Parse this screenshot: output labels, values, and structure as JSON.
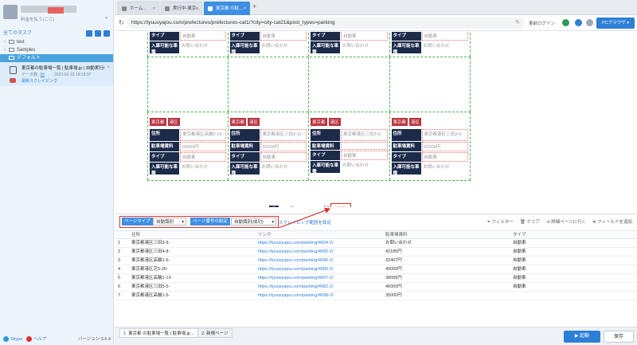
{
  "sidebar": {
    "account_sub": "料金を払う(ここ)",
    "all_tasks": "全てのタスク",
    "tree": [
      {
        "label": "test"
      },
      {
        "label": "Samples"
      },
      {
        "label": "デフォルト"
      }
    ],
    "task": {
      "title": "東京都の駐車場一覧 | 駐車場.jp | 自動実行組",
      "count_label": "データ数:",
      "count": "16",
      "date": "2023-02-15 18:19:37",
      "link": "最新スクレイピング"
    },
    "footer": {
      "skype": "Skype",
      "help": "ヘルプ",
      "version": "バージョン:3.6.4"
    }
  },
  "browser": {
    "tabs": [
      {
        "label": "ホーム..."
      },
      {
        "label": "実行中-東京..."
      },
      {
        "label": "東京都 の駐..."
      }
    ],
    "url": "https://tyuusyajou.com/prefectures/prefectures-cat1/?city=city-cat21&post_types=parking",
    "login": "事前ログイン",
    "pc_browser": "PCブラウザ"
  },
  "listing": {
    "row1": [
      {
        "type_k": "タイプ",
        "type_v": "自動車",
        "cars_k": "入庫可能な車種",
        "cars_v": "お問い合わせ"
      },
      {
        "type_k": "タイプ",
        "type_v": "自動車",
        "cars_k": "入庫可能な車種",
        "cars_v": "お問い合わせ"
      },
      {
        "type_k": "タイプ",
        "type_v": "自動車",
        "cars_k": "入庫可能な車種",
        "cars_v": "お問い合わせ"
      },
      {
        "type_k": "タイプ",
        "type_v": "自動車",
        "cars_k": "入庫可能な車種",
        "cars_v": "お問い合わせ"
      }
    ],
    "row3": [
      {
        "pref": "東京都",
        "ward": "港区",
        "addr_k": "住所",
        "addr_v": "東京都港区高輪2-19-",
        "fee_k": "駐車場賃料",
        "fee_v": "50000円",
        "type_k": "タイプ",
        "type_v": "自動車",
        "cars_k": "入庫可能な車種",
        "cars_v": "お問い合わせ"
      },
      {
        "pref": "東京都",
        "ward": "港区",
        "addr_k": "住所",
        "addr_v": "東京都港区三田3-11-",
        "fee_k": "駐車場賃料",
        "fee_v": "32000円",
        "type_k": "タイプ",
        "type_v": "自動車",
        "cars_k": "入庫可能な車種",
        "cars_v": "お問い合わせ"
      },
      {
        "pref": "東京都",
        "ward": "港区",
        "addr_k": "住所",
        "addr_v": "東京都港区三田3-9-",
        "fee_k": "駐車場賃料",
        "fee_v": "",
        "type_k": "タイプ",
        "type_v": "自動車",
        "cars_k": "入庫可能な車種",
        "cars_v": "お問い合わせ"
      },
      {
        "pref": "東京都",
        "ward": "港区",
        "addr_k": "住所",
        "addr_v": "東京都港区三田3-9-",
        "fee_k": "駐車場賃料",
        "fee_v": "52000円",
        "type_k": "タイプ",
        "type_v": "自動車",
        "cars_k": "入庫可能な車種",
        "cars_v": "お問い合わせ"
      }
    ],
    "pager": [
      "1",
      "2",
      "...",
      "53"
    ],
    "float_label": "折る"
  },
  "panel": {
    "page_type_label": "ページタイプ",
    "page_type_value": "自動識別",
    "page_num_label": "ページ番号の設定",
    "page_num_value": "自動識別(成功)",
    "scrape_range": "スクレイピング範囲を設定",
    "right_tools": [
      "フィルター",
      "クリア",
      "詳細ページに行く",
      "フィールドを追加"
    ],
    "columns": [
      "住所",
      "リンク",
      "駐車場賃料",
      "タイプ"
    ],
    "rows": [
      {
        "n": "1",
        "addr": "東京都港区三田3-9-",
        "link": "https://tyuusyajou.com/parking/4694-2/",
        "fee": "お問い合わせ",
        "type": "自動車"
      },
      {
        "n": "2",
        "addr": "東京都港区三田4-8-",
        "link": "https://tyuusyajou.com/parking/4695-2/",
        "fee": "42185円",
        "type": "自動車"
      },
      {
        "n": "3",
        "addr": "東京都港区高輪1-5-",
        "link": "https://tyuusyajou.com/parking/4696-2/",
        "fee": "32407円",
        "type": "自動車"
      },
      {
        "n": "4",
        "addr": "東京都港区芝5-26-",
        "link": "https://tyuusyajou.com/parking/4680-2/",
        "fee": "40000円",
        "type": "自動車"
      },
      {
        "n": "5",
        "addr": "東京都港区高輪1-13-",
        "link": "https://tyuusyajou.com/parking/4697-2/",
        "fee": "38095円",
        "type": "自動車"
      },
      {
        "n": "6",
        "addr": "東京都港区三田5-5-",
        "link": "https://tyuusyajou.com/parking/4682-2/",
        "fee": "46000円",
        "type": "自動車"
      },
      {
        "n": "7",
        "addr": "東京都港区高輪1-5-",
        "link": "https://tyuusyajou.com/parking/4698-2/",
        "fee": "35000円",
        "type": ""
      }
    ]
  },
  "bottom": {
    "tab1": "1. 東京都 の駐車場一覧 | 駐車場.jp ...",
    "tab2": "2. 新規ページ",
    "run": "起動",
    "save": "保存"
  },
  "colors": {
    "accent": "#2d7fd6",
    "tag_red": "#b8323d",
    "header_navy": "#1c2b4a",
    "highlight_red": "#d93030"
  }
}
